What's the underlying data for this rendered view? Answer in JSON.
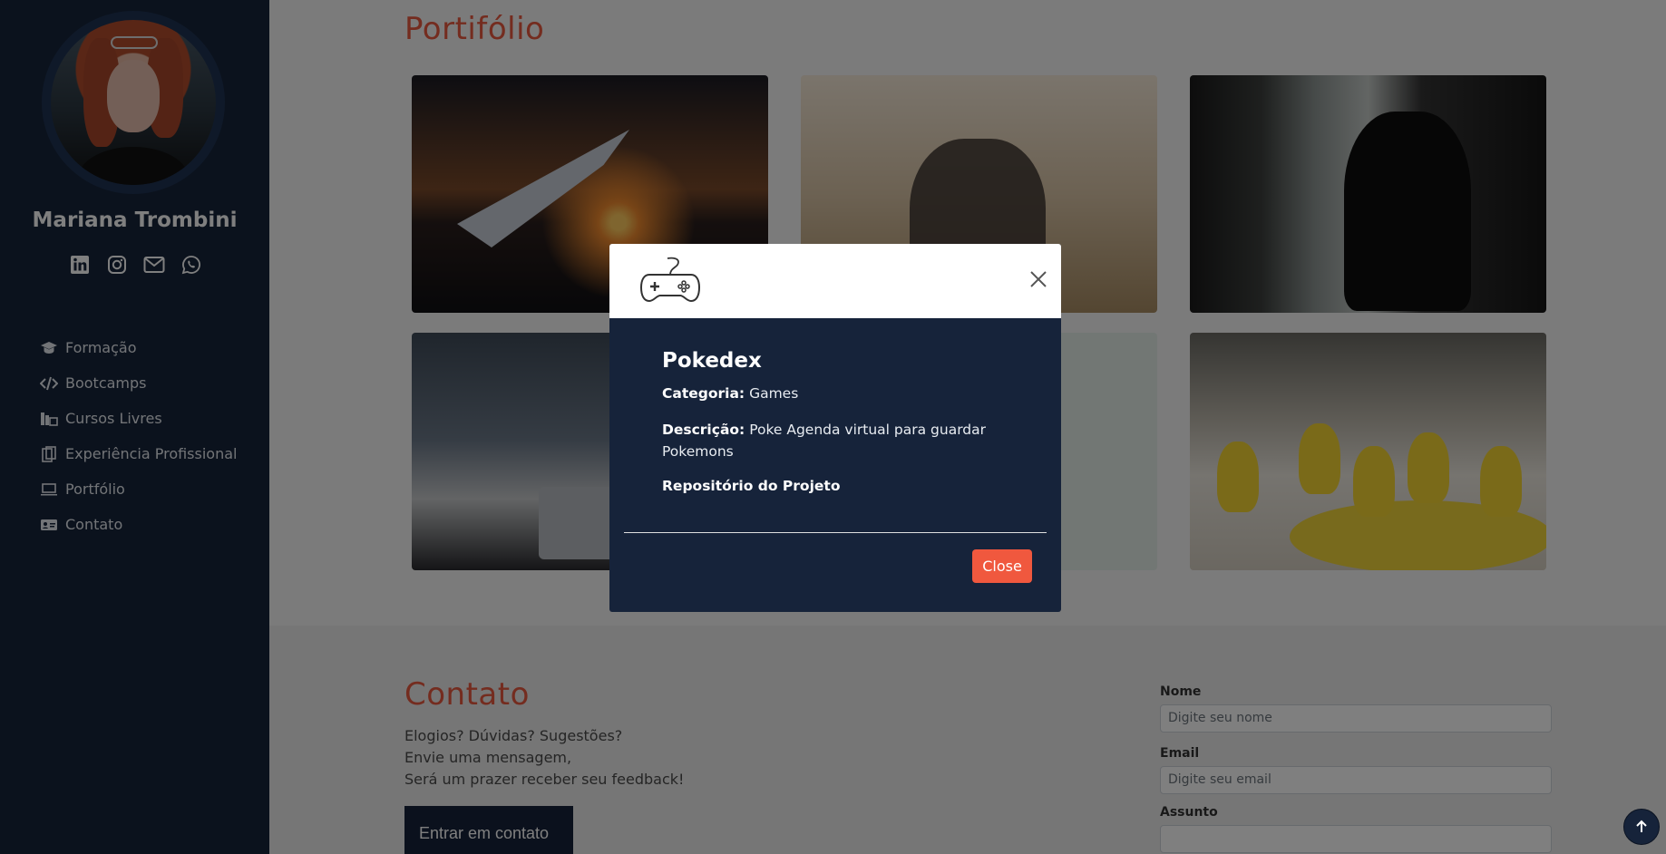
{
  "profile": {
    "name": "Mariana Trombini"
  },
  "socials": [
    {
      "icon": "linkedin-icon"
    },
    {
      "icon": "instagram-icon"
    },
    {
      "icon": "envelope-icon"
    },
    {
      "icon": "whatsapp-icon"
    }
  ],
  "nav": {
    "items": [
      {
        "label": "Formação",
        "icon": "graduation-cap-icon"
      },
      {
        "label": "Bootcamps",
        "icon": "code-icon"
      },
      {
        "label": "Cursos Livres",
        "icon": "books-icon"
      },
      {
        "label": "Experiência Profissional",
        "icon": "clipboard-icon"
      },
      {
        "label": "Portfólio",
        "icon": "laptop-icon"
      },
      {
        "label": "Contato",
        "icon": "contact-card-icon"
      }
    ]
  },
  "portfolio": {
    "title": "Portifólio"
  },
  "contact": {
    "title": "Contato",
    "lines": [
      "Elogios? Dúvidas? Sugestões?",
      "Envie uma mensagem,",
      "Será um prazer receber seu feedback!"
    ],
    "button": "Entrar em contato",
    "form": {
      "name_label": "Nome",
      "name_placeholder": "Digite seu nome",
      "email_label": "Email",
      "email_placeholder": "Digite seu email",
      "subject_label": "Assunto"
    }
  },
  "modal": {
    "project_name": "Pokedex",
    "category_label": "Categoria:",
    "category_value": "Games",
    "description_label": "Descrição:",
    "description_value": "Poke Agenda virtual para guardar Pokemons",
    "repo_link": "Repositório do Projeto",
    "close_button": "Close"
  },
  "colors": {
    "accent": "#e8583f",
    "navy": "#16233a",
    "close_button": "#f0583e"
  }
}
